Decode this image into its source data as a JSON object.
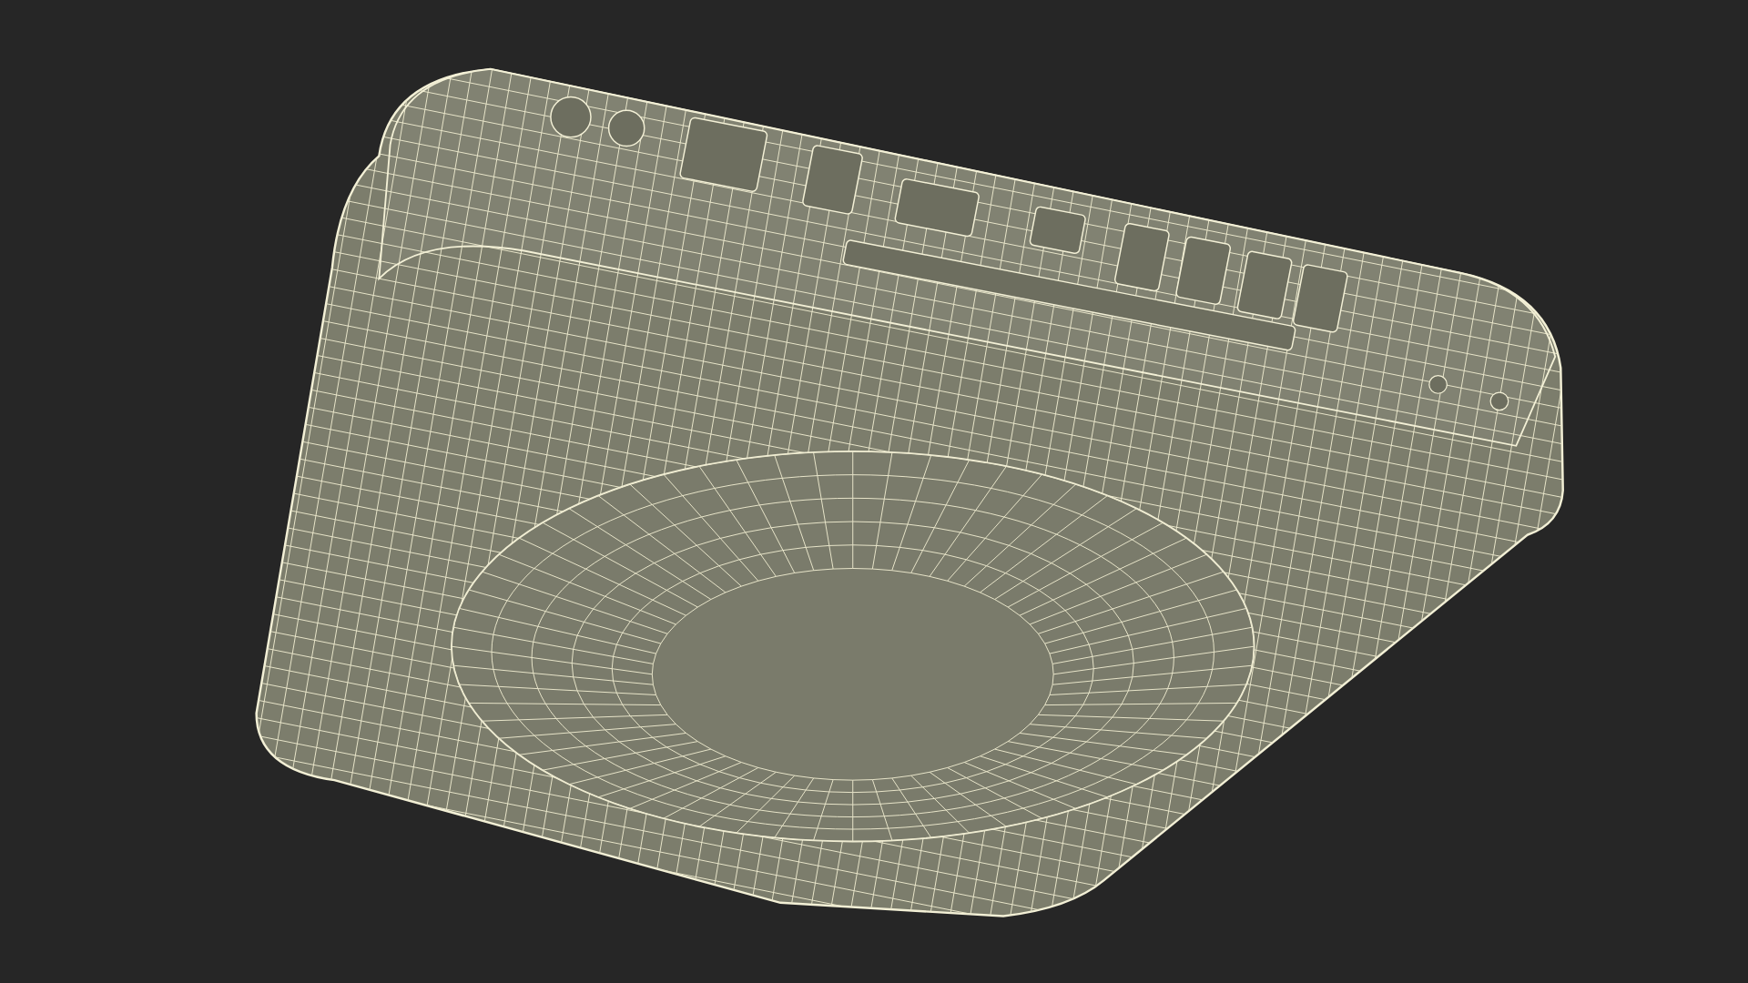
{
  "render": {
    "kind": "wireframe"
  }
}
